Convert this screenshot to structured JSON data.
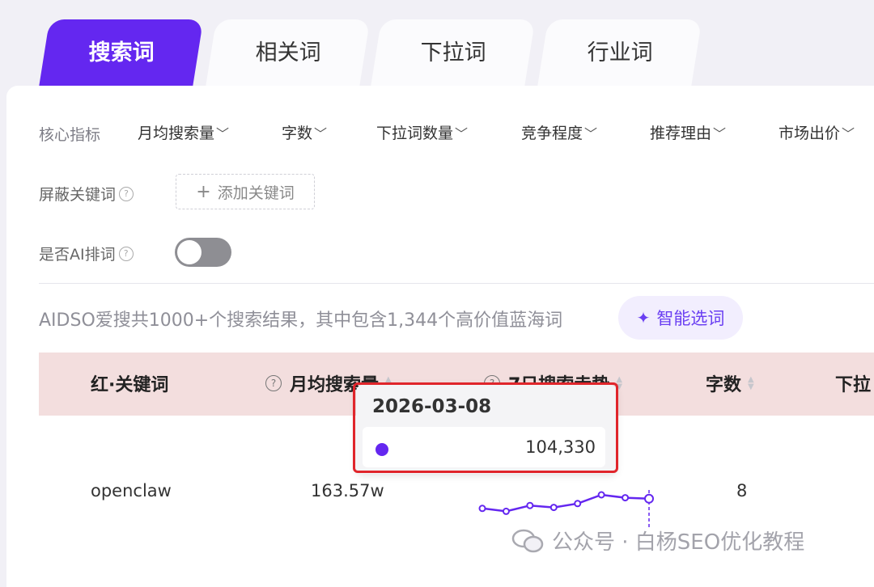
{
  "tabs": [
    {
      "label": "搜索词",
      "active": true
    },
    {
      "label": "相关词",
      "active": false
    },
    {
      "label": "下拉词",
      "active": false
    },
    {
      "label": "行业词",
      "active": false
    }
  ],
  "filters": {
    "core_label": "核心指标",
    "items": [
      "月均搜索量",
      "字数",
      "下拉词数量",
      "竞争程度",
      "推荐理由",
      "市场出价"
    ]
  },
  "block_keywords": {
    "label": "屏蔽关键词",
    "add_label": "添加关键词"
  },
  "ai_sort": {
    "label": "是否AI排词",
    "enabled": false
  },
  "summary": {
    "text": "AIDSO爱搜共1000+个搜索结果，其中包含1,344个高价值蓝海词",
    "smart_button": "智能选词"
  },
  "table": {
    "headers": [
      "红·关键词",
      "月均搜索量",
      "7日搜索走势",
      "字数",
      "下拉"
    ],
    "rows": [
      {
        "keyword": "openclaw",
        "monthly_search": "163.57w",
        "char_count": "8"
      }
    ]
  },
  "trend_chart": {
    "values": [
      0.3,
      0.15,
      0.45,
      0.35,
      0.55,
      1.0,
      0.85,
      0.8
    ],
    "highlight_index": 7,
    "color": "#6427f0"
  },
  "tooltip": {
    "date": "2026-03-08",
    "value": "104,330"
  },
  "watermark": {
    "text": "公众号 · 白杨SEO优化教程"
  },
  "colors": {
    "accent": "#6427f0",
    "highlight_box": "#e0252b",
    "header_bg": "#f3dede"
  }
}
